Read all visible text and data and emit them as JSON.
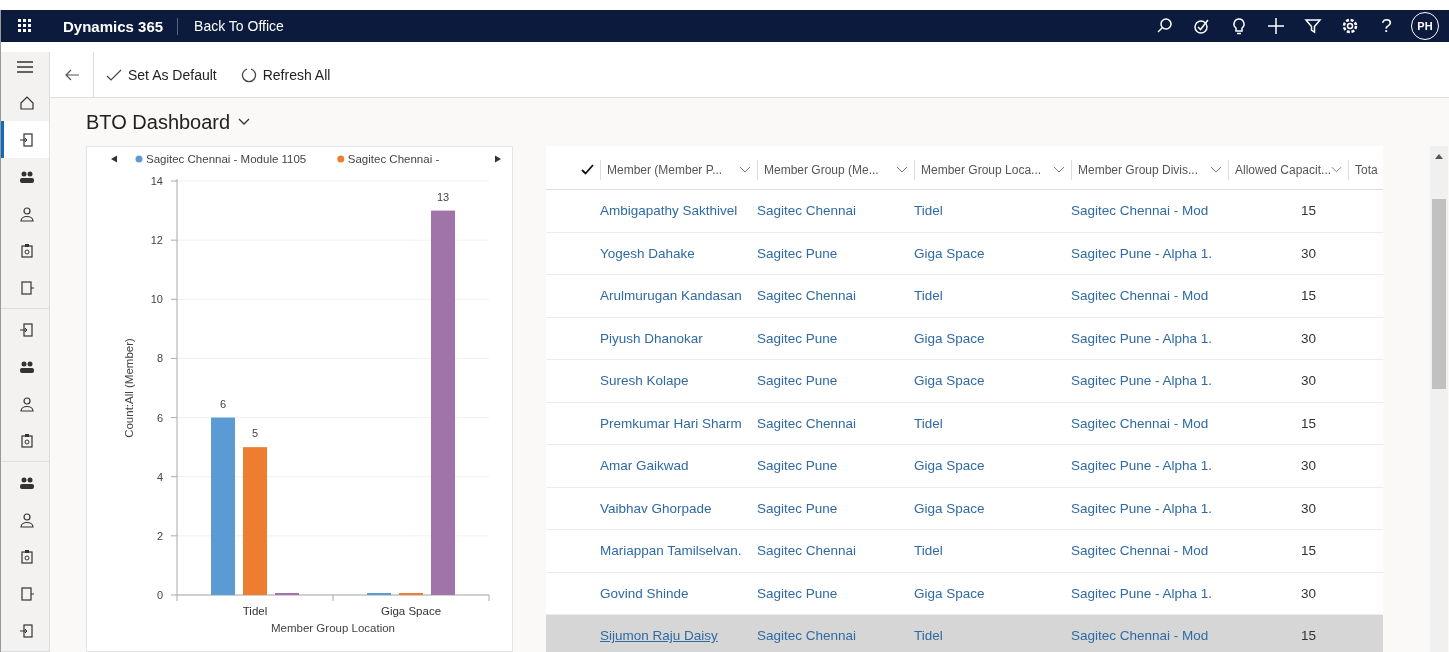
{
  "top_bar": {
    "app_name": "Dynamics 365",
    "app_title": "Back To Office",
    "help": "?",
    "avatar": "PH"
  },
  "command_bar": {
    "buttons": [
      "Set As Default",
      "Refresh All"
    ]
  },
  "sidebar": {
    "groups": [
      [
        {
          "selected": false
        },
        {
          "selected": true
        },
        {
          "selected": false
        },
        {
          "selected": false
        },
        {
          "selected": false
        },
        {
          "selected": false
        }
      ],
      [
        {
          "selected": false
        },
        {
          "selected": false
        },
        {
          "selected": false
        },
        {
          "selected": false
        }
      ],
      [
        {
          "selected": false
        },
        {
          "selected": false
        },
        {
          "selected": false
        },
        {
          "selected": false
        },
        {
          "selected": false
        }
      ]
    ]
  },
  "dashboard": {
    "title": "BTO Dashboard"
  },
  "chart": {
    "chart_data": {
      "type": "bar",
      "xlabel": "Member Group Location",
      "ylabel": "Count:All (Member)",
      "categories": [
        "Tidel",
        "Giga Space"
      ],
      "series": [
        {
          "name": "Sagitec Chennai - Module 1105",
          "color": "#5b9bd5",
          "values": [
            6,
            0
          ]
        },
        {
          "name": "Sagitec Chennai -",
          "color": "#ed7d31",
          "values": [
            5,
            0
          ]
        },
        {
          "color": "#a074a8",
          "values": [
            0,
            13
          ]
        }
      ],
      "ylim": [
        0,
        14
      ],
      "yticks": [
        0,
        2,
        4,
        6,
        8,
        10,
        12,
        14
      ],
      "value_labels": [
        [
          "6",
          null
        ],
        [
          "5",
          null
        ],
        [
          null,
          "13"
        ]
      ],
      "grid": true,
      "legend": "top"
    }
  },
  "grid": {
    "columns": [
      "Member (Member P...",
      "Member Group (Me...",
      "Member Group Loca...",
      "Member Group Divis...",
      "Allowed Capacit...",
      "Tota"
    ],
    "rows": [
      {
        "member": "Ambigapathy Sakthivel",
        "member_group": "Sagitec Chennai",
        "location": "Tidel",
        "division": "Sagitec Chennai - Mod",
        "allowed_capacity": "15",
        "selected": false
      },
      {
        "member": "Yogesh Dahake",
        "member_group": "Sagitec Pune",
        "location": "Giga Space",
        "division": "Sagitec Pune - Alpha 1.",
        "allowed_capacity": "30",
        "selected": false
      },
      {
        "member": "Arulmurugan Kandasan",
        "member_group": "Sagitec Chennai",
        "location": "Tidel",
        "division": "Sagitec Chennai - Mod",
        "allowed_capacity": "15",
        "selected": false
      },
      {
        "member": "Piyush Dhanokar",
        "member_group": "Sagitec Pune",
        "location": "Giga Space",
        "division": "Sagitec Pune - Alpha 1.",
        "allowed_capacity": "30",
        "selected": false
      },
      {
        "member": "Suresh Kolape",
        "member_group": "Sagitec Pune",
        "location": "Giga Space",
        "division": "Sagitec Pune - Alpha 1.",
        "allowed_capacity": "30",
        "selected": false
      },
      {
        "member": "Premkumar Hari Sharm",
        "member_group": "Sagitec Chennai",
        "location": "Tidel",
        "division": "Sagitec Chennai - Mod",
        "allowed_capacity": "15",
        "selected": false
      },
      {
        "member": "Amar Gaikwad",
        "member_group": "Sagitec Pune",
        "location": "Giga Space",
        "division": "Sagitec Pune - Alpha 1.",
        "allowed_capacity": "30",
        "selected": false
      },
      {
        "member": "Vaibhav Ghorpade",
        "member_group": "Sagitec Pune",
        "location": "Giga Space",
        "division": "Sagitec Pune - Alpha 1.",
        "allowed_capacity": "30",
        "selected": false
      },
      {
        "member": "Mariappan Tamilselvan.",
        "member_group": "Sagitec Chennai",
        "location": "Tidel",
        "division": "Sagitec Chennai - Mod",
        "allowed_capacity": "15",
        "selected": false
      },
      {
        "member": "Govind Shinde",
        "member_group": "Sagitec Pune",
        "location": "Giga Space",
        "division": "Sagitec Pune - Alpha 1.",
        "allowed_capacity": "30",
        "selected": false
      },
      {
        "member": "Sijumon Raju Daisy",
        "member_group": "Sagitec Chennai",
        "location": "Tidel",
        "division": "Sagitec Chennai - Mod",
        "allowed_capacity": "15",
        "selected": true
      }
    ]
  }
}
